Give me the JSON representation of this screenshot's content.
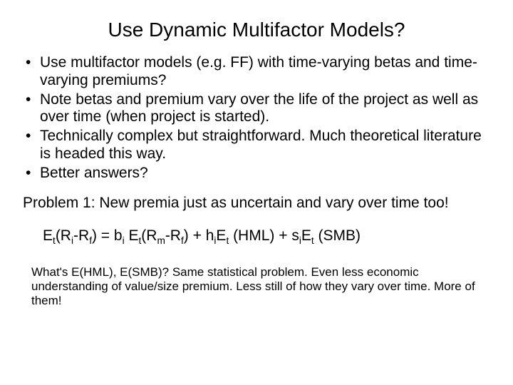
{
  "title": "Use Dynamic Multifactor Models?",
  "bullets": [
    "Use multifactor models (e.g. FF) with time-varying betas and time-varying premiums?",
    "Note betas and premium vary over the life of the project as well as over time (when project is started).",
    "Technically complex but straightforward. Much theoretical literature is headed this way.",
    "Better answers?"
  ],
  "problem": "Problem 1: New premia just as uncertain and vary over time too!",
  "equation": {
    "lhs_base": "E",
    "lhs_sub1": "t",
    "lhs_inner": "(R",
    "lhs_sub2": "i",
    "lhs_minus": "-R",
    "lhs_sub3": "f",
    "lhs_close": ") = b",
    "b_sub": "i",
    "sp1": " E",
    "e1_sub": "t",
    "rm": "(R",
    "rm_sub": "m",
    "rm_minus": "-R",
    "rf_sub": "f",
    "rm_close": ") + h",
    "h_sub": "i",
    "dot1": "E",
    "e2_sub": "t",
    "hml": " (HML) + s",
    "s_sub": "i",
    "dot2": "E",
    "e3_sub": "t",
    "smb": " (SMB)"
  },
  "footnote": "What's E(HML), E(SMB)? Same statistical problem. Even less economic understanding of value/size premium. Less still of how they vary over time. More of them!"
}
